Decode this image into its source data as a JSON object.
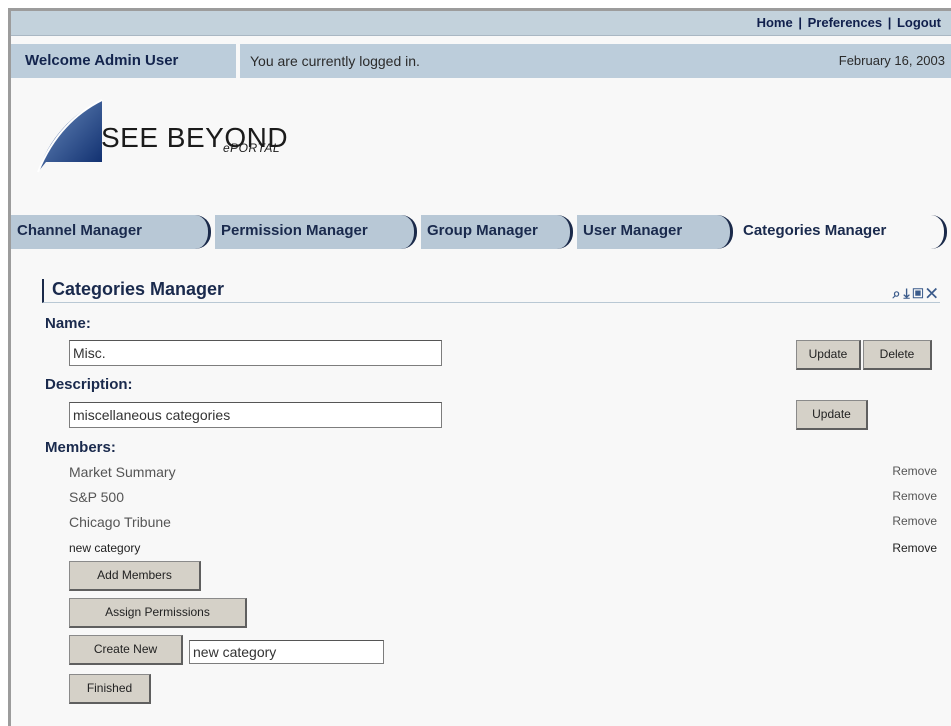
{
  "top_links": {
    "home": "Home",
    "preferences": "Preferences",
    "logout": "Logout",
    "separator": "|"
  },
  "welcome": "Welcome Admin User",
  "status": {
    "message": "You are currently logged in.",
    "date": "February 16, 2003"
  },
  "logo": {
    "name": "SEE BEYOND",
    "product": "ePORTAL"
  },
  "tabs": [
    {
      "label": "Channel Manager"
    },
    {
      "label": "Permission Manager"
    },
    {
      "label": "Group Manager"
    },
    {
      "label": "User Manager"
    },
    {
      "label": "Categories Manager",
      "active": true
    }
  ],
  "section": {
    "title": "Categories Manager",
    "icons": [
      "search-icon",
      "download-icon",
      "edit-icon",
      "close-icon"
    ]
  },
  "form": {
    "name_label": "Name:",
    "name_value": "Misc.",
    "update_label": "Update",
    "delete_label": "Delete",
    "description_label": "Description:",
    "description_value": "miscellaneous categories",
    "members_label": "Members:",
    "members": [
      {
        "name": "Market Summary",
        "remove": "Remove"
      },
      {
        "name": "S&P 500",
        "remove": "Remove"
      },
      {
        "name": "Chicago Tribune",
        "remove": "Remove"
      },
      {
        "name": "new category",
        "remove": "Remove"
      }
    ],
    "add_members_label": "Add Members",
    "assign_permissions_label": "Assign Permissions",
    "create_new_label": "Create New",
    "create_new_value": "new category",
    "finished_label": "Finished"
  }
}
